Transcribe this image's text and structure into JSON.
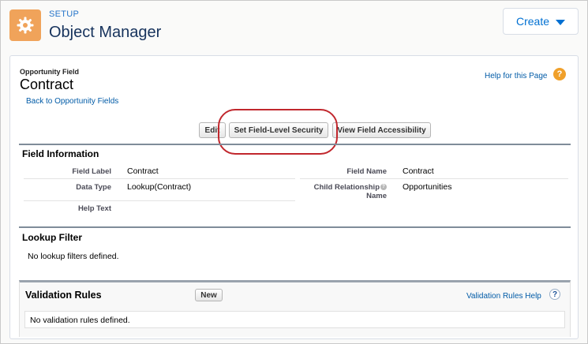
{
  "header": {
    "setup_label": "SETUP",
    "title": "Object Manager",
    "create_label": "Create",
    "icon": "gear-icon"
  },
  "object": {
    "type_label": "Opportunity Field",
    "name": "Contract",
    "back_link": "Back to Opportunity Fields",
    "help_link": "Help for this Page",
    "help_icon": "?"
  },
  "buttons": {
    "edit": "Edit",
    "field_level_security": "Set Field-Level Security",
    "view_accessibility": "View Field Accessibility"
  },
  "field_info": {
    "title": "Field Information",
    "left": [
      {
        "label": "Field Label",
        "value": "Contract"
      },
      {
        "label": "Data Type",
        "value": "Lookup(Contract)"
      },
      {
        "label": "Help Text",
        "value": ""
      }
    ],
    "right": [
      {
        "label": "Field Name",
        "value": "Contract"
      },
      {
        "label": "Child Relationship Name",
        "label_line1": "Child Relationship",
        "label_line2": "Name",
        "value": "Opportunities"
      }
    ]
  },
  "lookup_filter": {
    "title": "Lookup Filter",
    "empty_text": "No lookup filters defined."
  },
  "validation_rules": {
    "title": "Validation Rules",
    "new_label": "New",
    "help_link": "Validation Rules Help",
    "help_icon": "?",
    "empty_text": "No validation rules defined."
  },
  "colors": {
    "accent": "#0070d2",
    "gear_tile": "#f0a35a",
    "highlight": "#c1272d"
  }
}
